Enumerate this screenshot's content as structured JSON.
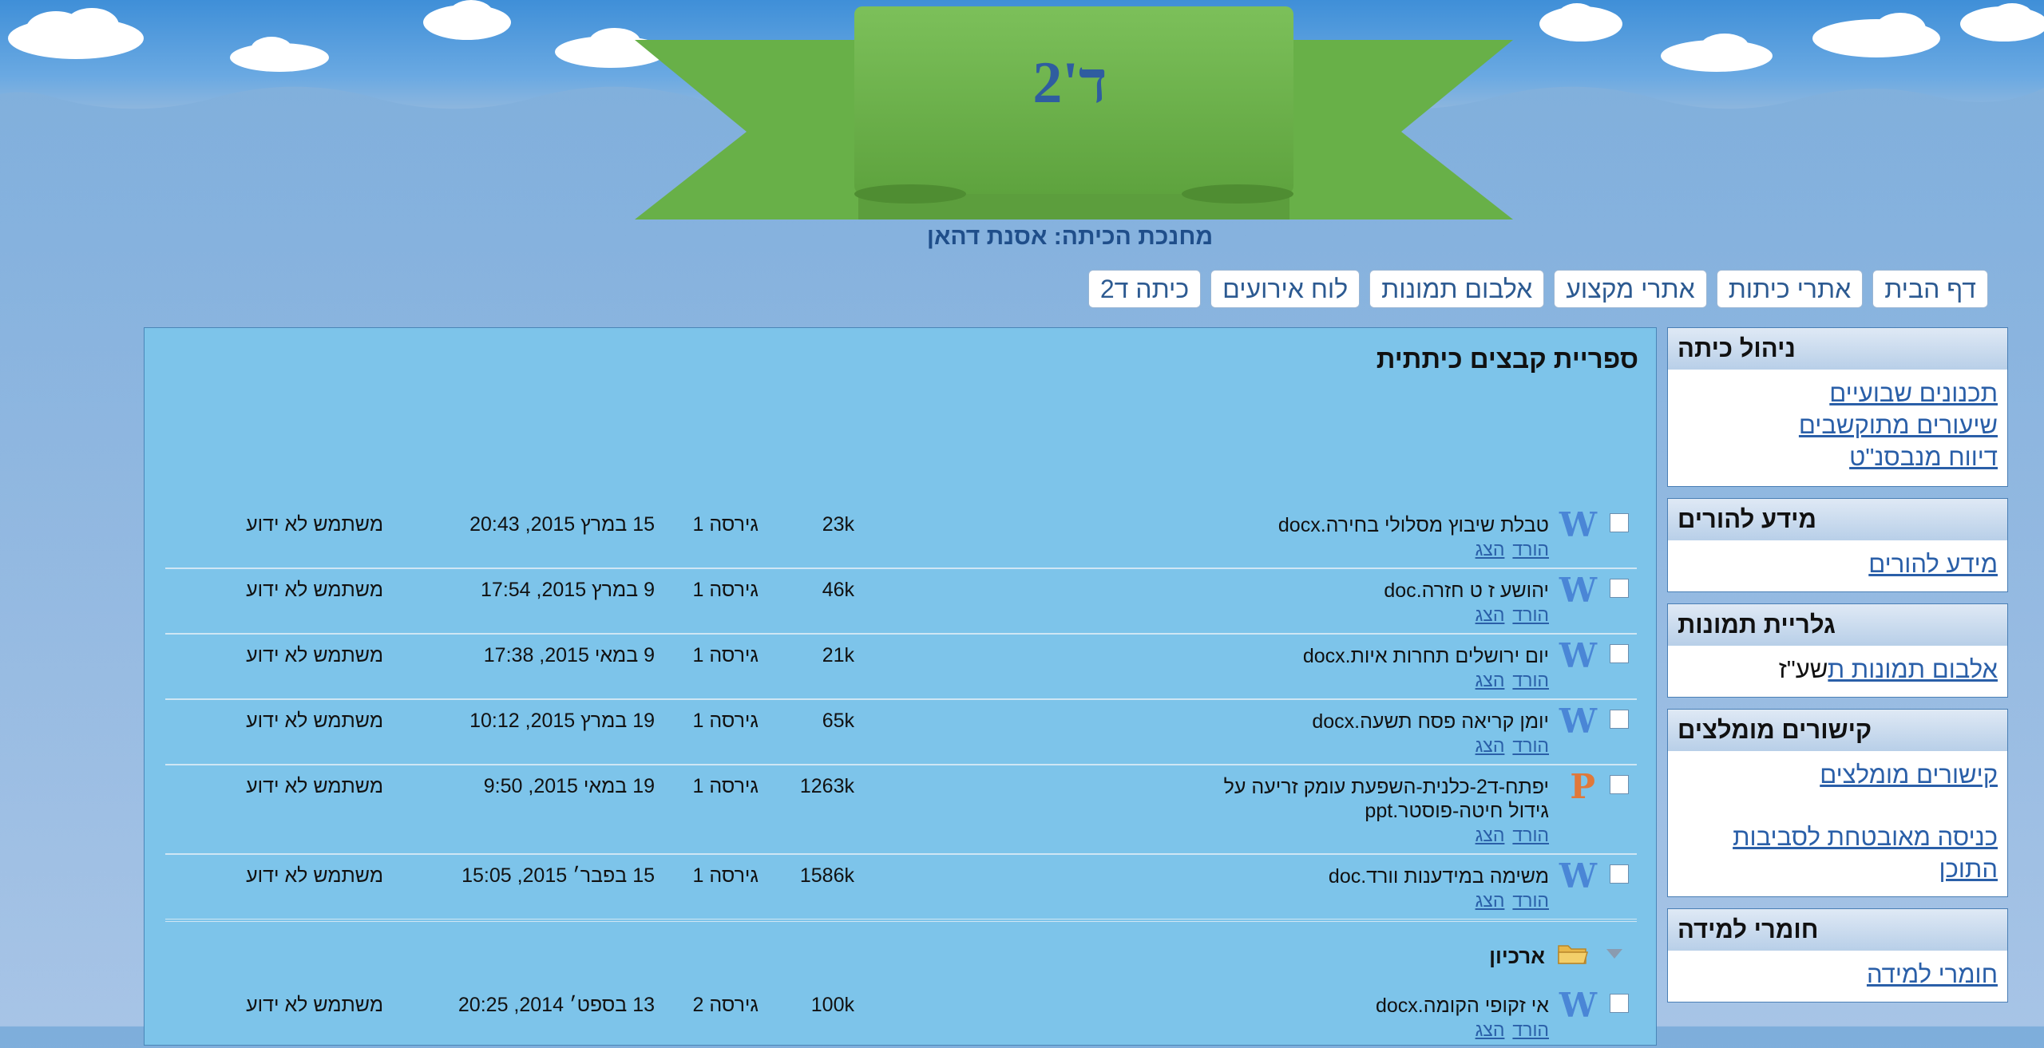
{
  "header": {
    "site_title": "ד'2",
    "teacher_line": "מחנכת הכיתה: אסנת דהאן"
  },
  "nav": {
    "items": [
      {
        "label": "דף הבית"
      },
      {
        "label": "אתרי כיתות"
      },
      {
        "label": "אתרי מקצוע"
      },
      {
        "label": "אלבום תמונות"
      },
      {
        "label": "לוח אירועים"
      },
      {
        "label": "כיתה ד2"
      }
    ]
  },
  "sidebar": {
    "class_admin": {
      "title": "ניהול כיתה",
      "links": [
        "תכנונים שבועיים",
        "שיעורים מתוקשבים",
        "דיווח מנבסנ\"ט"
      ]
    },
    "parents": {
      "title": "מידע להורים",
      "links": [
        "מידע להורים"
      ]
    },
    "gallery": {
      "title": "גלריית תמונות",
      "link_underlined": "אלבום תמונות ת",
      "link_plain": "שע\"ז"
    },
    "recommended": {
      "title": "קישורים מומלצים",
      "link1": "קישורים מומלצים",
      "link2": "כניסה מאובטחת לסביבות התוכן"
    },
    "learning": {
      "title": "חומרי למידה",
      "links": [
        "חומרי למידה"
      ]
    }
  },
  "library": {
    "title": "ספריית קבצים כיתתית",
    "action_download": "הורד",
    "action_view": "הצג",
    "files": [
      {
        "icon": "word",
        "name": "טבלת שיבוץ מסלולי בחירה.docx",
        "size": "23k",
        "version": "גירסה 1",
        "date": "15 במרץ 2015, 20:43",
        "user": "משתמש לא ידוע"
      },
      {
        "icon": "word",
        "name": "יהושע ז ט חזרה.doc",
        "size": "46k",
        "version": "גירסה 1",
        "date": "9 במרץ 2015, 17:54",
        "user": "משתמש לא ידוע"
      },
      {
        "icon": "word",
        "name": "יום ירושלים תחרות איות.docx",
        "size": "21k",
        "version": "גירסה 1",
        "date": "9 במאי 2015, 17:38",
        "user": "משתמש לא ידוע"
      },
      {
        "icon": "word",
        "name": "יומן קריאה פסח תשעה.docx",
        "size": "65k",
        "version": "גירסה 1",
        "date": "19 במרץ 2015, 10:12",
        "user": "משתמש לא ידוע"
      },
      {
        "icon": "ppt",
        "name": "יפתח-ד2-כלנית-השפעת עומק זריעה על גידול חיטה-פוסטר.ppt",
        "size": "1263k",
        "version": "גירסה 1",
        "date": "19 במאי 2015, 9:50",
        "user": "משתמש לא ידוע"
      },
      {
        "icon": "word",
        "name": "משימה במידענות וורד.doc",
        "size": "1586k",
        "version": "גירסה 1",
        "date": "15 בפבר׳ 2015, 15:05",
        "user": "משתמש לא ידוע"
      }
    ],
    "folder": {
      "label": "ארכיון"
    },
    "archive_file": {
      "icon": "word",
      "name": "אי זקופי הקומה.docx",
      "size": "100k",
      "version": "גירסה 2",
      "date": "13 בספט׳ 2014, 20:25",
      "user": "משתמש לא ידוע"
    }
  }
}
